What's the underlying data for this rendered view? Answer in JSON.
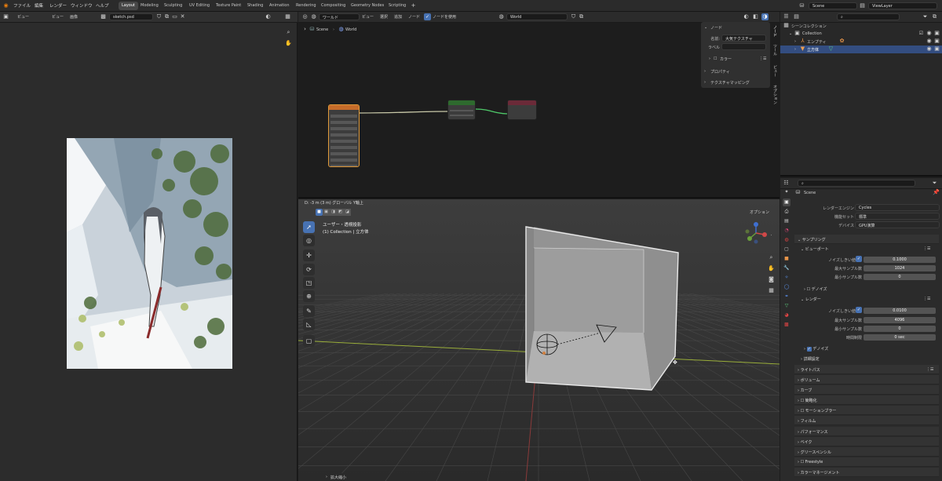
{
  "topbar": {
    "menus": [
      "ファイル",
      "編集",
      "レンダー",
      "ウィンドウ",
      "ヘルプ"
    ],
    "workspaces": [
      "Layout",
      "Modeling",
      "Sculpting",
      "UV Editing",
      "Texture Paint",
      "Shading",
      "Animation",
      "Rendering",
      "Compositing",
      "Geometry Nodes",
      "Scripting"
    ],
    "active_workspace": "Layout",
    "scene": "Scene",
    "view_layer": "ViewLayer"
  },
  "image_editor": {
    "menus": [
      "ビュー",
      "ビュー",
      "画像"
    ],
    "image_name": "sketch.psd"
  },
  "node_editor": {
    "world_type": "ワールド",
    "menus": [
      "ビュー",
      "選択",
      "追加",
      "ノード"
    ],
    "use_nodes_label": "ノードを使用",
    "world_name": "World",
    "breadcrumb_scene": "Scene",
    "breadcrumb_world": "World",
    "npanel": {
      "section": "ノード",
      "name_label": "名前:",
      "name_value": "大気テクスチャ",
      "label_label": "ラベル",
      "color_label": "カラー",
      "properties_label": "プロパティ",
      "texture_mapping_label": "テクスチャマッピング",
      "tabs": [
        "ノード",
        "ツール",
        "ビュー",
        "オプション"
      ]
    }
  },
  "viewport": {
    "header_text": "D: -3 m (3 m) グローバル Y軸上",
    "options_label": "オプション",
    "view_name": "ユーザー・透視投影",
    "collection_info": "(1) Collection | 立方体",
    "bottom_label": "拡大縮小"
  },
  "outliner": {
    "scene_collection": "シーンコレクション",
    "items": [
      {
        "name": "Collection",
        "level": 1
      },
      {
        "name": "エンプティ",
        "level": 2
      },
      {
        "name": "立方体",
        "level": 2
      }
    ]
  },
  "properties": {
    "scene_label": "Scene",
    "render_engine_label": "レンダーエンジン",
    "render_engine": "Cycles",
    "feature_set_label": "機能セット",
    "feature_set": "標準",
    "device_label": "デバイス",
    "device": "GPU演算",
    "sampling_label": "サンプリング",
    "viewport_label": "ビューポート",
    "noise_threshold_label": "ノイズしきい値",
    "viewport_noise": "0.1000",
    "max_samples_label": "最大サンプル数",
    "viewport_max": "1024",
    "min_samples_label": "最小サンプル数",
    "viewport_min": "0",
    "denoise_label": "デノイズ",
    "render_label": "レンダー",
    "render_noise": "0.0100",
    "render_max": "4096",
    "render_min": "0",
    "time_limit_label": "時間制限",
    "time_limit": "0 sec",
    "advanced_label": "詳細設定",
    "sections": [
      "ライトパス",
      "ボリューム",
      "カーブ",
      "簡略化",
      "モーションブラー",
      "フィルム",
      "パフォーマンス",
      "ベイク",
      "グリースペンシル",
      "Freestyle",
      "カラーマネージメント"
    ]
  },
  "colors": {
    "accent": "#4772b3",
    "selection": "#334d80",
    "node_texture": "#c66c2a",
    "node_background": "#2e6a2e",
    "node_output": "#6b2a38"
  }
}
